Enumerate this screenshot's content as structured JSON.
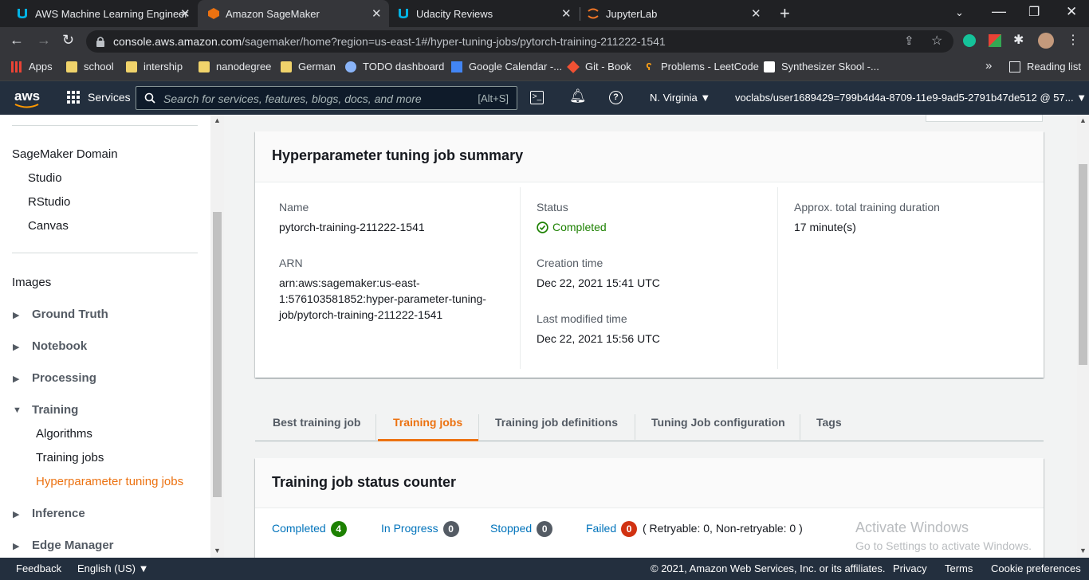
{
  "browser": {
    "tabs": [
      {
        "title": "AWS Machine Learning Engineer",
        "icon": "udacity-icon"
      },
      {
        "title": "Amazon SageMaker",
        "icon": "sagemaker-icon"
      },
      {
        "title": "Udacity Reviews",
        "icon": "udacity-icon"
      },
      {
        "title": "JupyterLab",
        "icon": "jupyter-icon"
      }
    ],
    "new_tab": "+",
    "url_host": "console.aws.amazon.com",
    "url_path": "/sagemaker/home?region=us-east-1#/hyper-tuning-jobs/pytorch-training-211222-1541",
    "bookmarks": [
      "Apps",
      "school",
      "intership",
      "nanodegree",
      "German",
      "TODO dashboard",
      "Google Calendar -...",
      "Git - Book",
      "Problems - LeetCode",
      "Synthesizer Skool -..."
    ],
    "more_bookmarks": "»",
    "reading_list": "Reading list"
  },
  "aws_header": {
    "logo": "aws",
    "services": "Services",
    "search_placeholder": "Search for services, features, blogs, docs, and more",
    "search_shortcut": "[Alt+S]",
    "region": "N. Virginia",
    "account": "voclabs/user1689429=799b4d4a-8709-11e9-9ad5-2791b47de512 @ 57..."
  },
  "sidebar": {
    "domain_title": "SageMaker Domain",
    "domain_items": [
      "Studio",
      "RStudio",
      "Canvas"
    ],
    "images": "Images",
    "sections": [
      "Ground Truth",
      "Notebook",
      "Processing"
    ],
    "training": {
      "label": "Training",
      "items": [
        "Algorithms",
        "Training jobs",
        "Hyperparameter tuning jobs"
      ]
    },
    "more_sections": [
      "Inference",
      "Edge Manager"
    ]
  },
  "summary": {
    "title": "Hyperparameter tuning job summary",
    "name_label": "Name",
    "name_value": "pytorch-training-211222-1541",
    "arn_label": "ARN",
    "arn_lines": [
      "arn:aws:sagemaker:us-east-",
      "1:576103581852:hyper-parameter-tuning-",
      "job/pytorch-training-211222-1541"
    ],
    "status_label": "Status",
    "status_value": "Completed",
    "creation_label": "Creation time",
    "creation_value": "Dec 22, 2021 15:41 UTC",
    "modified_label": "Last modified time",
    "modified_value": "Dec 22, 2021 15:56 UTC",
    "duration_label": "Approx. total training duration",
    "duration_value": "17 minute(s)"
  },
  "tabs": [
    "Best training job",
    "Training jobs",
    "Training job definitions",
    "Tuning Job configuration",
    "Tags"
  ],
  "counter": {
    "title": "Training job status counter",
    "completed": {
      "label": "Completed",
      "count": "4",
      "color": "#1d8102"
    },
    "in_progress": {
      "label": "In Progress",
      "count": "0",
      "color": "#545b64"
    },
    "stopped": {
      "label": "Stopped",
      "count": "0",
      "color": "#545b64"
    },
    "failed": {
      "label": "Failed",
      "count": "0",
      "color": "#d13212"
    },
    "retry_text": "( Retryable: 0, Non-retryable: 0 )"
  },
  "watermark": {
    "line1": "Activate Windows",
    "line2": "Go to Settings to activate Windows."
  },
  "footer": {
    "feedback": "Feedback",
    "language": "English (US)",
    "copyright": "© 2021, Amazon Web Services, Inc. or its affiliates.",
    "privacy": "Privacy",
    "terms": "Terms",
    "cookies": "Cookie preferences"
  },
  "colors": {
    "accent": "#ec7211",
    "link": "#0073bb",
    "success": "#1d8102",
    "aws_navy": "#232f3e"
  }
}
